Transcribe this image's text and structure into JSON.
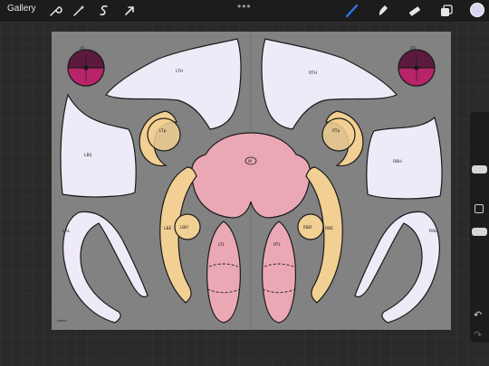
{
  "toolbar": {
    "gallery_label": "Gallery",
    "more_label": "•••",
    "left_tools": [
      "wrench-icon",
      "magic-wand-icon",
      "selection-s-icon",
      "transform-arrow-icon"
    ],
    "right_tools": [
      "brush-icon",
      "smudge-icon",
      "eraser-icon",
      "layers-icon"
    ],
    "active_color": "#ddd3f2",
    "accent": "#2b7bf5"
  },
  "sidebar": {
    "undo": "↶",
    "redo": "↷"
  },
  "canvas": {
    "colors": {
      "background": "#828282",
      "lavender": "#efeaf7",
      "cream": "#f2cf92",
      "pink": "#eaa8b5",
      "maroon": "#5b1a3e",
      "magenta": "#b8246a",
      "outline": "#1a1a1a"
    },
    "labels": {
      "top_left_circle": "LTL",
      "top_right_circle": "RTL",
      "left_top_hood": "LTH",
      "right_top_hood": "RTH",
      "left_body_side": "LBS",
      "right_body_side": "RBH",
      "left_thigh": "LTp",
      "right_thigh": "RTp",
      "main_head": "M",
      "left_belly": "LBE",
      "right_belly": "RBE",
      "left_small_circle": "LBEf",
      "right_small_circle": "RBEf",
      "left_leg": "LTL",
      "right_leg": "RTL",
      "left_arm": "LAL",
      "right_arm": "RAL",
      "signature": "sketch"
    }
  }
}
